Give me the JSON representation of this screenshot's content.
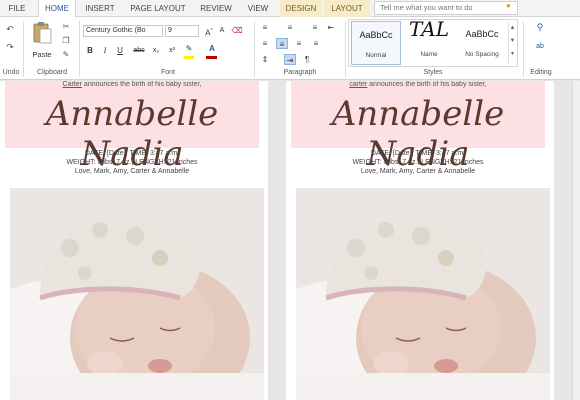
{
  "tabs": [
    {
      "label": "FILE",
      "active": false,
      "contextual": false
    },
    {
      "label": "HOME",
      "active": true,
      "contextual": false
    },
    {
      "label": "INSERT",
      "active": false,
      "contextual": false
    },
    {
      "label": "PAGE LAYOUT",
      "active": false,
      "contextual": false
    },
    {
      "label": "REVIEW",
      "active": false,
      "contextual": false
    },
    {
      "label": "VIEW",
      "active": false,
      "contextual": false
    },
    {
      "label": "DESIGN",
      "active": false,
      "contextual": true
    },
    {
      "label": "LAYOUT",
      "active": false,
      "contextual": true
    }
  ],
  "tell_me": {
    "placeholder": "Tell me what you want to do"
  },
  "ribbon": {
    "undo_group": {
      "label": "Undo"
    },
    "clipboard": {
      "label": "Clipboard",
      "paste_label": "Paste"
    },
    "font": {
      "label": "Font",
      "font_name": "Century Gothic (Bo",
      "font_size": "9",
      "bold": "B",
      "italic": "I",
      "underline": "U",
      "strike": "abc",
      "subscript": "x₂",
      "superscript": "x²",
      "font_color": "A"
    },
    "paragraph": {
      "label": "Paragraph"
    },
    "styles": {
      "label": "Styles",
      "items": [
        {
          "sample": "AaBbCc",
          "name": "Normal",
          "selected": true
        },
        {
          "sample": "TAL",
          "name": "Name",
          "selected": false
        },
        {
          "sample": "AaBbCc",
          "name": "No Spacing",
          "selected": false
        }
      ]
    },
    "editing": {
      "label": "Editing"
    }
  },
  "pages": [
    {
      "intro_prefix": "Carter",
      "intro_rest": " announces the birth of his baby sister,",
      "baby_name": "Annabelle Nadia",
      "details_line1": "DATE: [Date], TIME: 3:47 a.m.",
      "details_line2": "WEIGHT: 8 lbs. 7 oz., LENGTH: 21 inches",
      "details_line3": "Love, Mark, Amy, Carter & Annabelle"
    },
    {
      "intro_prefix": "carter",
      "intro_rest": " announces the birth of his baby sister,",
      "baby_name": "Annabelle Nadia",
      "details_line1": "DATE: [Date], TIME: 3:47 a.m.",
      "details_line2": "WEIGHT: 8 lbs. 7 oz., LENGTH: 21 inches",
      "details_line3": "Love, Mark, Amy, Carter & Annabelle"
    }
  ],
  "colors": {
    "accent": "#2b579a",
    "banner": "#fde0e4",
    "name_text": "#5a3a2e"
  }
}
